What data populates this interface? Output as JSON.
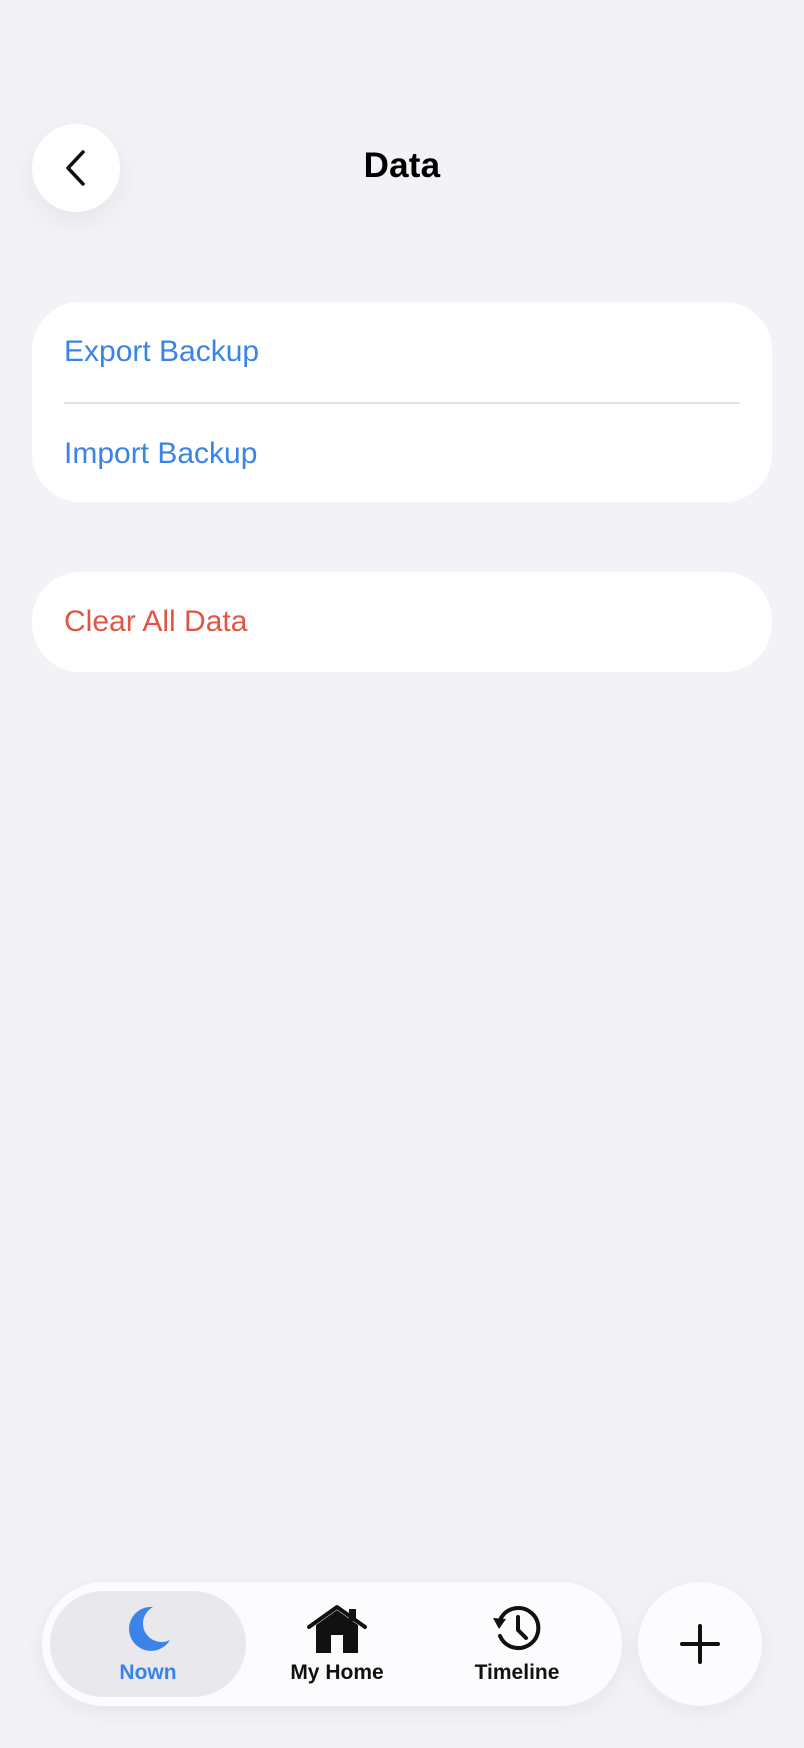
{
  "header": {
    "title": "Data",
    "back_icon": "chevron-left-icon"
  },
  "backup_section": {
    "items": [
      {
        "label": "Export Backup",
        "color": "#3a84e8"
      },
      {
        "label": "Import Backup",
        "color": "#3a84e8"
      }
    ]
  },
  "danger_section": {
    "items": [
      {
        "label": "Clear All Data",
        "color": "#e25545"
      }
    ]
  },
  "tabbar": {
    "tabs": [
      {
        "label": "Nown",
        "icon": "moon-icon",
        "active": true
      },
      {
        "label": "My Home",
        "icon": "house-icon",
        "active": false
      },
      {
        "label": "Timeline",
        "icon": "history-clock-icon",
        "active": false
      }
    ],
    "add_icon": "plus-icon"
  },
  "colors": {
    "accent": "#3a84e8",
    "destructive": "#e25545",
    "background": "#f2f2f7",
    "card": "#ffffff"
  }
}
